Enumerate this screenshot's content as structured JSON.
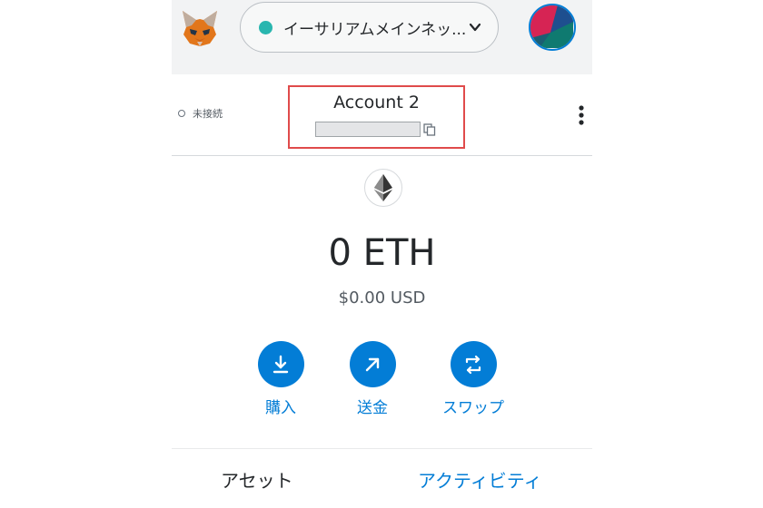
{
  "header": {
    "logo_icon": "metamask-fox-icon",
    "network": {
      "label": "イーサリアムメインネッ...",
      "status_color": "#29b6af"
    },
    "avatar_icon": "account-identicon"
  },
  "account": {
    "connection_status": "未接続",
    "name": "Account 2",
    "address_redacted": true
  },
  "wallet": {
    "balance": "0 ETH",
    "fiat": "$0.00 USD",
    "token_icon": "ethereum-icon"
  },
  "actions": [
    {
      "label": "購入",
      "icon": "download-arrow-icon"
    },
    {
      "label": "送金",
      "icon": "send-arrow-icon"
    },
    {
      "label": "スワップ",
      "icon": "swap-arrows-icon"
    }
  ],
  "tabs": [
    {
      "label": "アセット",
      "active": false
    },
    {
      "label": "アクティビティ",
      "active": true
    }
  ],
  "colors": {
    "accent": "#037dd6",
    "highlight_border": "#e04b4b"
  }
}
